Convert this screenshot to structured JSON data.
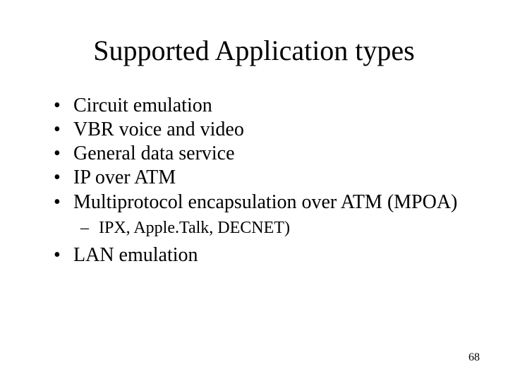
{
  "title": "Supported Application types",
  "bullets": {
    "b0": "Circuit emulation",
    "b1": "VBR voice and video",
    "b2": "General data service",
    "b3": "IP over ATM",
    "b4": "Multiprotocol encapsulation over ATM (MPOA)",
    "sub0": "IPX, Apple.Talk, DECNET)",
    "b5": "LAN emulation"
  },
  "page_number": "68"
}
